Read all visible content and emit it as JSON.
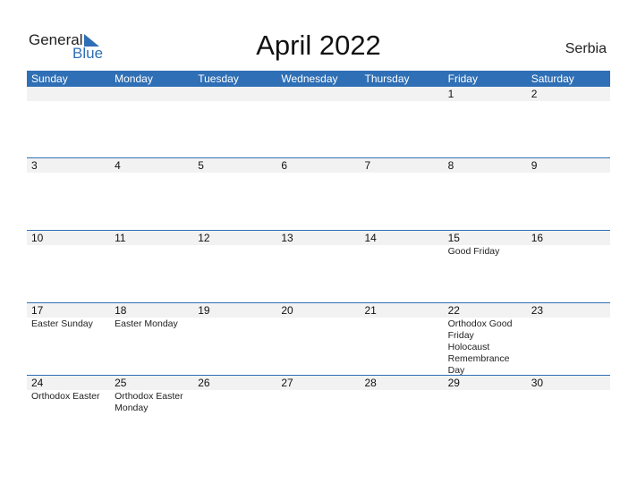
{
  "brand": {
    "general": "General",
    "blue": "Blue"
  },
  "title": "April 2022",
  "country": "Serbia",
  "weekdays": [
    "Sunday",
    "Monday",
    "Tuesday",
    "Wednesday",
    "Thursday",
    "Friday",
    "Saturday"
  ],
  "weeks": [
    [
      {
        "d": "",
        "e": ""
      },
      {
        "d": "",
        "e": ""
      },
      {
        "d": "",
        "e": ""
      },
      {
        "d": "",
        "e": ""
      },
      {
        "d": "",
        "e": ""
      },
      {
        "d": "1",
        "e": ""
      },
      {
        "d": "2",
        "e": ""
      }
    ],
    [
      {
        "d": "3",
        "e": ""
      },
      {
        "d": "4",
        "e": ""
      },
      {
        "d": "5",
        "e": ""
      },
      {
        "d": "6",
        "e": ""
      },
      {
        "d": "7",
        "e": ""
      },
      {
        "d": "8",
        "e": ""
      },
      {
        "d": "9",
        "e": ""
      }
    ],
    [
      {
        "d": "10",
        "e": ""
      },
      {
        "d": "11",
        "e": ""
      },
      {
        "d": "12",
        "e": ""
      },
      {
        "d": "13",
        "e": ""
      },
      {
        "d": "14",
        "e": ""
      },
      {
        "d": "15",
        "e": "Good Friday"
      },
      {
        "d": "16",
        "e": ""
      }
    ],
    [
      {
        "d": "17",
        "e": "Easter Sunday"
      },
      {
        "d": "18",
        "e": "Easter Monday"
      },
      {
        "d": "19",
        "e": ""
      },
      {
        "d": "20",
        "e": ""
      },
      {
        "d": "21",
        "e": ""
      },
      {
        "d": "22",
        "e": "Orthodox Good\nFriday\n  Holocaust\nRemembrance Day"
      },
      {
        "d": "23",
        "e": ""
      }
    ],
    [
      {
        "d": "24",
        "e": "Orthodox Easter"
      },
      {
        "d": "25",
        "e": "Orthodox Easter\nMonday"
      },
      {
        "d": "26",
        "e": ""
      },
      {
        "d": "27",
        "e": ""
      },
      {
        "d": "28",
        "e": ""
      },
      {
        "d": "29",
        "e": ""
      },
      {
        "d": "30",
        "e": ""
      }
    ]
  ]
}
